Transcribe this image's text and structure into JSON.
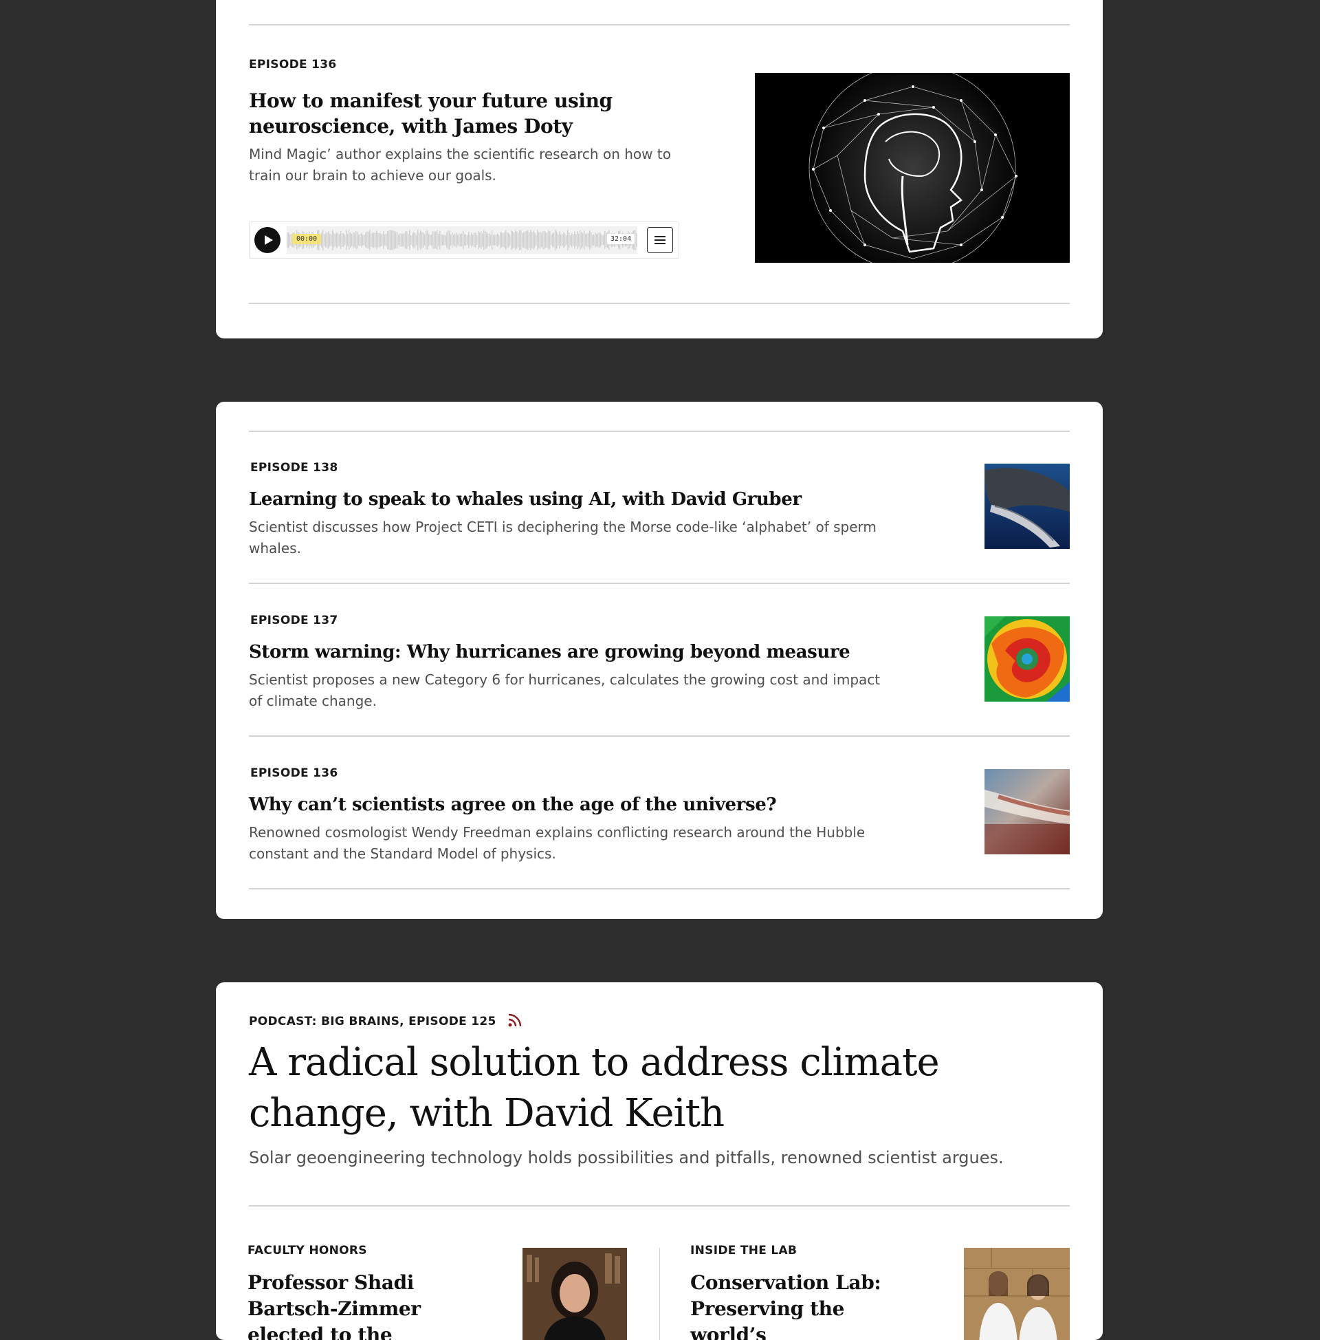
{
  "featured": {
    "episode_label": "EPISODE 136",
    "title": "How to manifest your future using neuroscience, with James Doty",
    "description": "Mind Magic’ author explains the scientific research on how to train our brain to achieve our goals.",
    "player": {
      "current_time": "00:00",
      "duration": "32:04",
      "progress": 0
    },
    "image_icon": "brain-network-profile-image"
  },
  "episodes": [
    {
      "label": "EPISODE 138",
      "title": "Learning to speak to whales using AI, with David Gruber",
      "description": "Scientist discusses how Project CETI is deciphering the Morse code-like ‘alphabet’ of sperm whales.",
      "thumbnail": "sperm-whale-photo"
    },
    {
      "label": "EPISODE 137",
      "title": "Storm warning: Why hurricanes are growing beyond measure",
      "description": "Scientist proposes a new Category 6 for hurricanes, calculates the growing cost and impact of climate change.",
      "thumbnail": "hurricane-satellite-image"
    },
    {
      "label": "EPISODE 136",
      "title": "Why can’t scientists agree on the age of the universe?",
      "description": "Renowned cosmologist Wendy Freedman explains conflicting research around the Hubble constant and the Standard Model of physics.",
      "thumbnail": "galaxy-image"
    }
  ],
  "podcast": {
    "kicker": "PODCAST: BIG BRAINS, EPISODE 125",
    "title": "A radical solution to address climate change, with David Keith",
    "description": "Solar geoengineering technology holds possibilities and pitfalls, renowned scientist argues.",
    "rss_color": "#8b1a1a"
  },
  "stories": [
    {
      "kicker": "FACULTY HONORS",
      "title": "Professor Shadi Bartsch-Zimmer elected to the",
      "image": "portrait-photo"
    },
    {
      "kicker": "INSIDE THE LAB",
      "title": "Conservation Lab: Preserving the world’s",
      "image": "two-scientists-photo"
    }
  ],
  "colors": {
    "page_background": "#2d2d2d",
    "card_background": "#ffffff",
    "timestamp_highlight": "#f4e27a"
  }
}
